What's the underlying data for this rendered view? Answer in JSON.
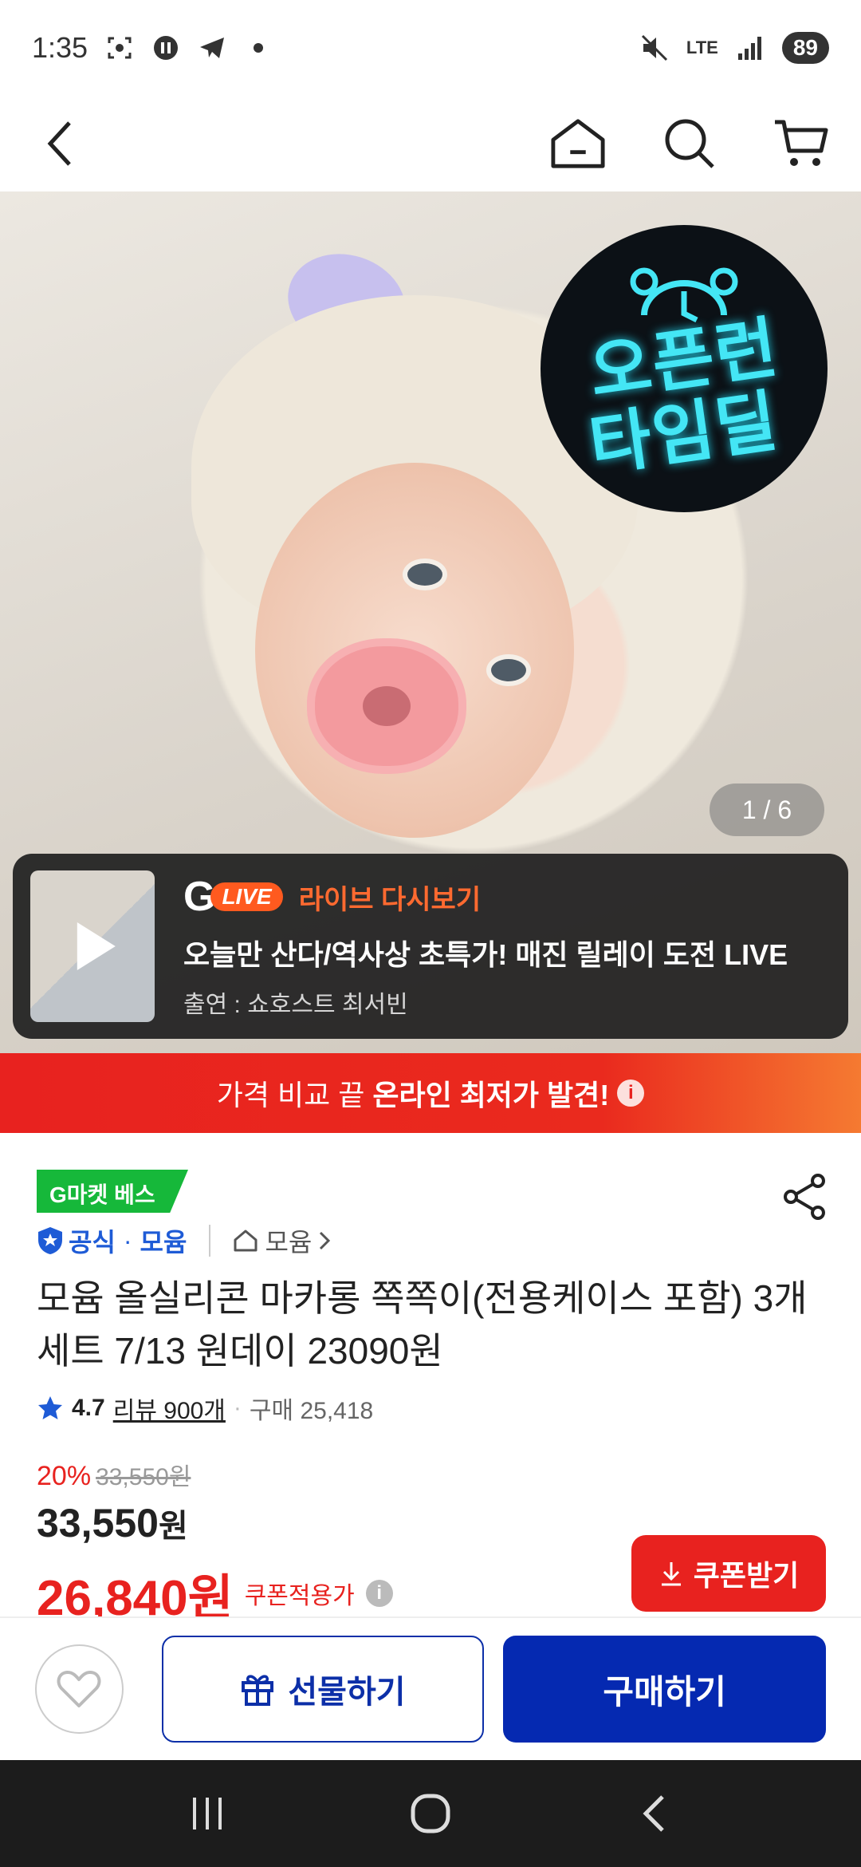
{
  "status_bar": {
    "time": "1:35",
    "network": "LTE",
    "battery": "89",
    "icons": [
      "screenshot-icon",
      "app-notification-icon",
      "telegram-icon",
      "dot-icon",
      "mute-icon",
      "lte-icon",
      "signal-icon",
      "battery-icon"
    ]
  },
  "top_nav": {
    "icons": [
      "back-icon",
      "home-icon",
      "search-icon",
      "cart-icon"
    ]
  },
  "hero": {
    "badge_line1": "오픈런",
    "badge_line2": "타임딜",
    "page_indicator": "1 / 6"
  },
  "live_banner": {
    "brand_letter": "G",
    "live_pill": "LIVE",
    "label": "라이브 다시보기",
    "title": "오늘만 산다/역사상 초특가! 매진 릴레이 도전 LIVE",
    "host": "출연 : 쇼호스트 최서빈"
  },
  "price_banner": {
    "prefix": "가격 비교 끝",
    "highlight": "온라인 최저가 발견!",
    "info_glyph": "i"
  },
  "product": {
    "best_badge": "G마켓 베스트",
    "official_label": "공식",
    "brand": "모윰",
    "store_link": "모윰",
    "title": "모윰 올실리콘 마카롱 쪽쪽이(전용케이스 포함) 3개세트 7/13 원데이 23090원",
    "rating": "4.7",
    "reviews": "리뷰 900개",
    "purchases": "구매 25,418",
    "discount_rate": "20%",
    "original_price": "33,550원",
    "sale_price": "33,550",
    "sale_price_unit": "원",
    "coupon_price": "26,840원",
    "coupon_price_label": "쿠폰적용가",
    "coupon_button": "쿠폰받기"
  },
  "action_bar": {
    "gift_label": "선물하기",
    "buy_label": "구매하기"
  },
  "colors": {
    "accent_red": "#e8221f",
    "accent_blue": "#0529b1",
    "best_green": "#16b83a",
    "live_orange": "#ff5a1f"
  }
}
